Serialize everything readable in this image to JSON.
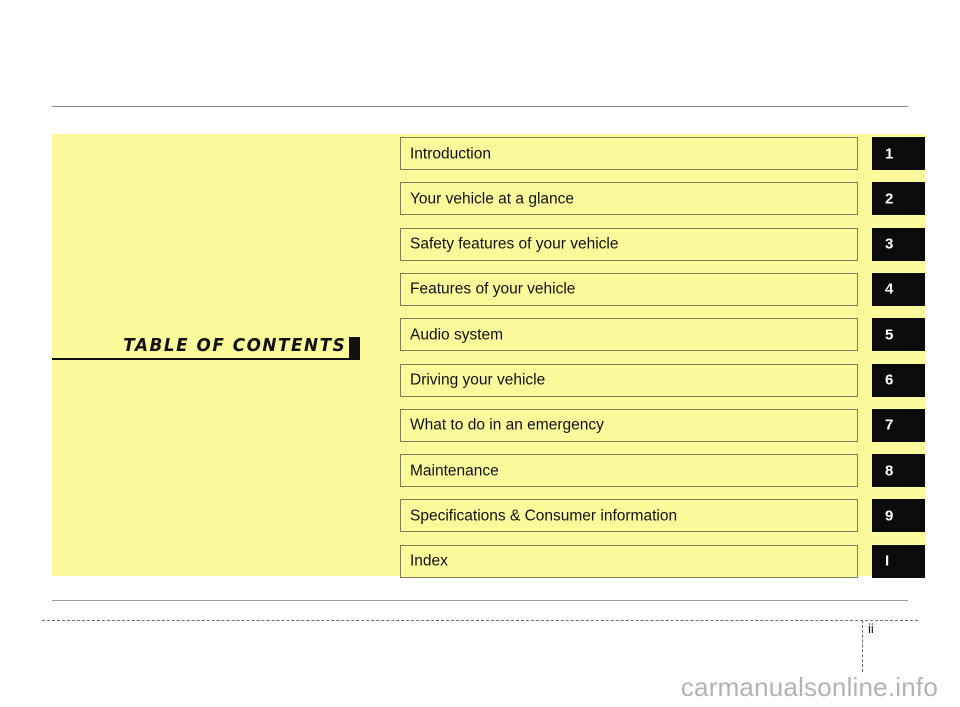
{
  "document": {
    "title": "TABLE  OF  CONTENTS",
    "page_number": "ii",
    "watermark": "carmanualsonline.info"
  },
  "colors": {
    "panel_background": "#fbfb9c",
    "row_border": "#7d7d5b",
    "tab_background": "#0b0b0b",
    "tab_text": "#ffffff",
    "rule": "#8a8a8a",
    "watermark": "#b3b3b3"
  },
  "contents": {
    "rows": [
      {
        "label": "Introduction",
        "tab": "1"
      },
      {
        "label": "Your vehicle at a glance",
        "tab": "2"
      },
      {
        "label": "Safety features of your vehicle",
        "tab": "3"
      },
      {
        "label": "Features of your vehicle",
        "tab": "4"
      },
      {
        "label": "Audio system",
        "tab": "5"
      },
      {
        "label": "Driving your vehicle",
        "tab": "6"
      },
      {
        "label": "What to do in an emergency",
        "tab": "7"
      },
      {
        "label": "Maintenance",
        "tab": "8"
      },
      {
        "label": "Specifications & Consumer information",
        "tab": "9"
      },
      {
        "label": "Index",
        "tab": "I"
      }
    ]
  }
}
